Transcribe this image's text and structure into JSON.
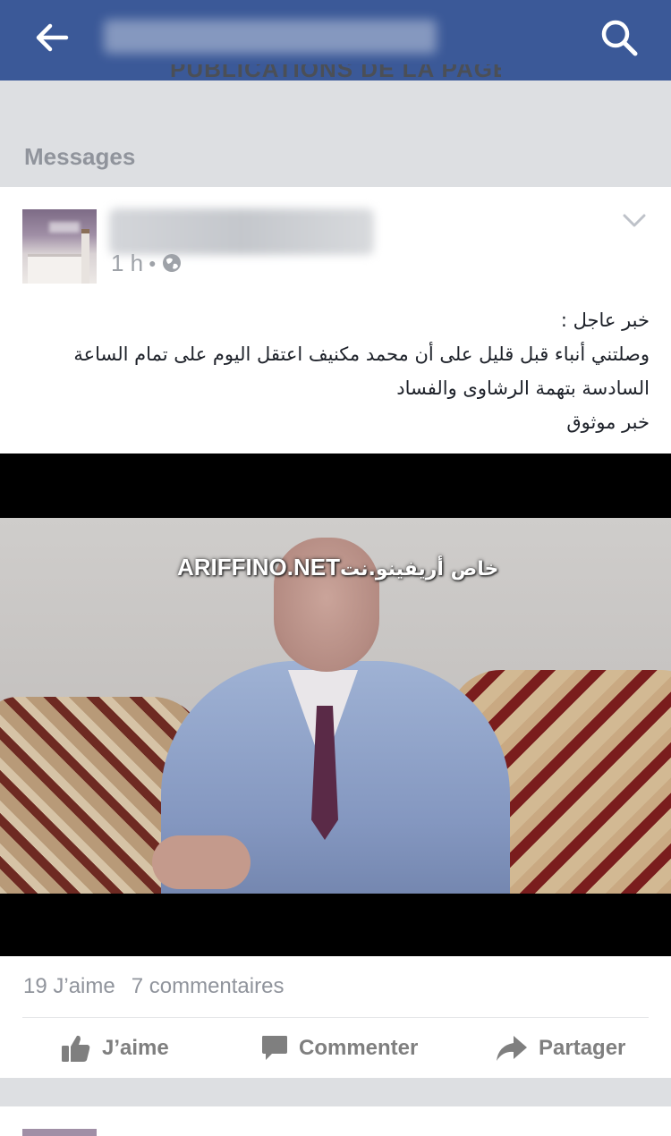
{
  "topbar": {
    "title": "Ya zaman ya zaman",
    "back_icon": "arrow-left-icon",
    "search_icon": "search-icon",
    "bg_color": "#3b5998"
  },
  "page": {
    "cut_header": "PUBLICATIONS DE LA PAGE",
    "section_label": "Messages"
  },
  "post": {
    "author": "Ya zaman ya zaman",
    "time": "1 h",
    "audience_icon": "globe-icon",
    "menu_icon": "chevron-down-icon",
    "lines": [
      "خبر عاجل :",
      "وصلتني أنباء قبل قليل على أن محمد مكنيف اعتقل اليوم على تمام الساعة",
      "السادسة بتهمة الرشاوى والفساد",
      "خبر موثوق"
    ],
    "video": {
      "watermark_latin": "ARIFFINO.NET",
      "watermark_arabic": "خاص أريفينو.نت"
    },
    "likes": "19 J’aime",
    "comments": "7 commentaires",
    "actions": {
      "like": "J’aime",
      "comment": "Commenter",
      "share": "Partager"
    }
  }
}
